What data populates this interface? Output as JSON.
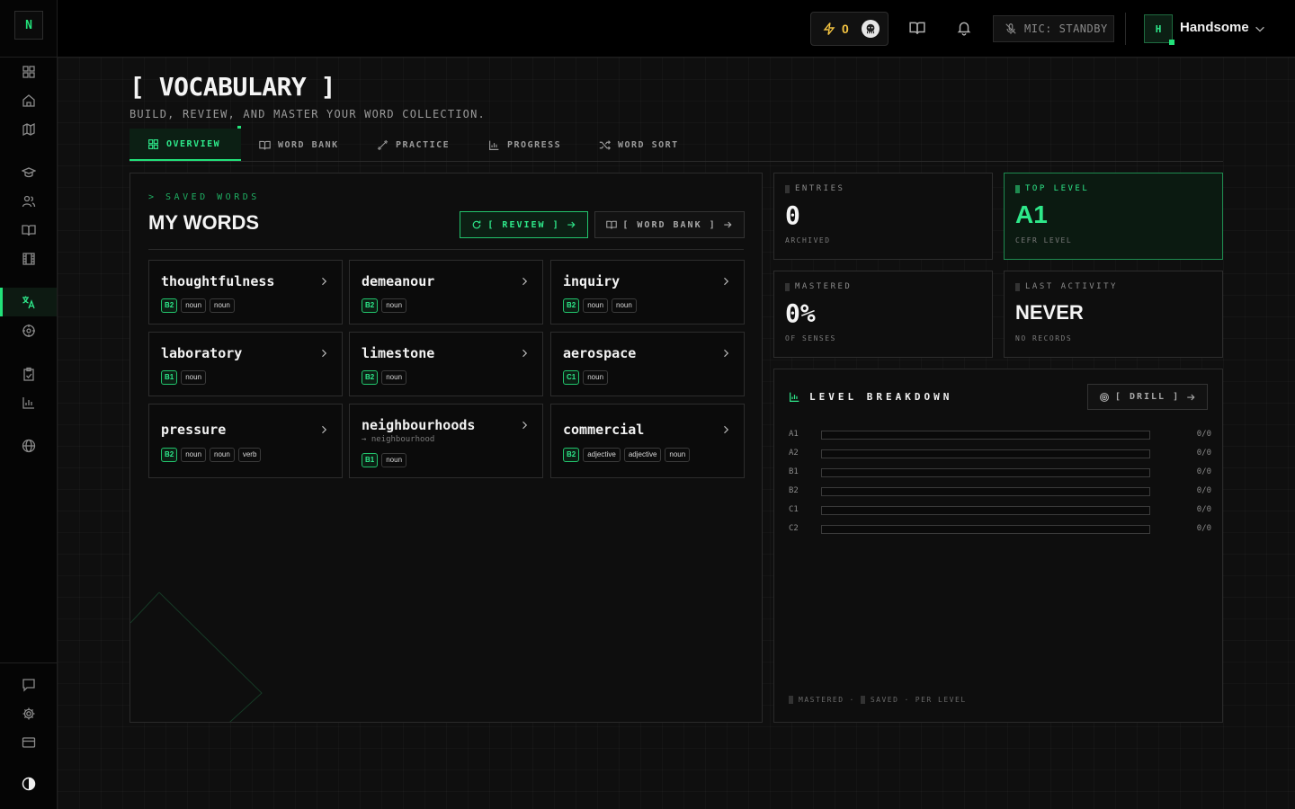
{
  "sidebar": {
    "logo": "N",
    "icons": [
      "dashboard-icon",
      "home-icon",
      "map-icon",
      "graduation-cap-icon",
      "users-icon",
      "book-icon",
      "film-icon",
      "translate-icon",
      "target-icon",
      "clipboard-icon",
      "bar-chart-icon",
      "globe-icon",
      "chat-icon",
      "settings-icon",
      "card-icon",
      "theme-toggle-icon"
    ],
    "active": "translate-icon"
  },
  "header": {
    "xp_value": "0",
    "mic_label": "MIC: STANDBY",
    "user_initial": "H",
    "user_name": "Handsome"
  },
  "page": {
    "title": "[ VOCABULARY ]",
    "subtitle": "BUILD, REVIEW, AND MASTER YOUR WORD COLLECTION."
  },
  "tabs": [
    {
      "label": "OVERVIEW",
      "active": true
    },
    {
      "label": "WORD BANK",
      "active": false
    },
    {
      "label": "PRACTICE",
      "active": false
    },
    {
      "label": "PROGRESS",
      "active": false
    },
    {
      "label": "WORD SORT",
      "active": false
    }
  ],
  "my_words": {
    "kicker": "> SAVED WORDS",
    "title": "MY WORDS",
    "review_button": "[ REVIEW ]",
    "word_bank_button": "[ WORD BANK ]",
    "words": [
      {
        "word": "thoughtfulness",
        "level": "B2",
        "tags": [
          "noun",
          "noun"
        ],
        "sub": ""
      },
      {
        "word": "demeanour",
        "level": "B2",
        "tags": [
          "noun"
        ],
        "sub": ""
      },
      {
        "word": "inquiry",
        "level": "B2",
        "tags": [
          "noun",
          "noun"
        ],
        "sub": ""
      },
      {
        "word": "laboratory",
        "level": "B1",
        "tags": [
          "noun"
        ],
        "sub": ""
      },
      {
        "word": "limestone",
        "level": "B2",
        "tags": [
          "noun"
        ],
        "sub": ""
      },
      {
        "word": "aerospace",
        "level": "C1",
        "tags": [
          "noun"
        ],
        "sub": ""
      },
      {
        "word": "pressure",
        "level": "B2",
        "tags": [
          "noun",
          "noun",
          "verb"
        ],
        "sub": ""
      },
      {
        "word": "neighbourhoods",
        "level": "B1",
        "tags": [
          "noun"
        ],
        "sub": "→ neighbourhood"
      },
      {
        "word": "commercial",
        "level": "B2",
        "tags": [
          "adjective",
          "adjective",
          "noun"
        ],
        "sub": ""
      }
    ]
  },
  "stats": {
    "entries": {
      "label": "ENTRIES",
      "value": "0",
      "foot": "ARCHIVED"
    },
    "top_level": {
      "label": "TOP LEVEL",
      "value": "A1",
      "foot": "CEFR LEVEL"
    },
    "mastered": {
      "label": "MASTERED",
      "value": "0%",
      "foot": "OF SENSES"
    },
    "last_activity": {
      "label": "LAST ACTIVITY",
      "value": "NEVER",
      "foot": "NO RECORDS"
    }
  },
  "breakdown": {
    "title": "LEVEL BREAKDOWN",
    "drill_button": "[ DRILL ]",
    "rows": [
      {
        "level": "A1",
        "count": "0/0",
        "fraction": 0
      },
      {
        "level": "A2",
        "count": "0/0",
        "fraction": 0
      },
      {
        "level": "B1",
        "count": "0/0",
        "fraction": 0
      },
      {
        "level": "B2",
        "count": "0/0",
        "fraction": 0
      },
      {
        "level": "C1",
        "count": "0/0",
        "fraction": 0
      },
      {
        "level": "C2",
        "count": "0/0",
        "fraction": 0
      }
    ],
    "legend": {
      "mastered": "MASTERED",
      "saved": "SAVED",
      "per_level": "PER LEVEL",
      "sep": "·"
    }
  },
  "colors": {
    "accent": "#22e27a",
    "background": "#0f0f0f",
    "xp": "#f5c542"
  }
}
